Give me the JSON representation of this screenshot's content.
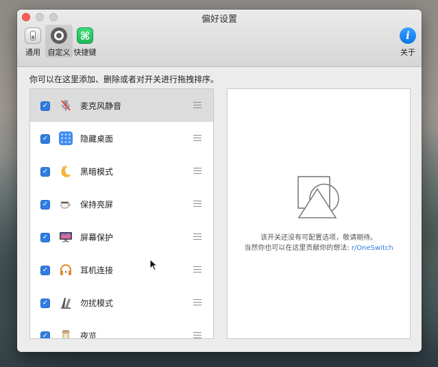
{
  "window": {
    "title": "偏好设置"
  },
  "toolbar": {
    "items": [
      {
        "label": "通用",
        "icon": "toggle-switch-icon"
      },
      {
        "label": "自定义",
        "icon": "custom-knob-icon",
        "active": true
      },
      {
        "label": "快捷键",
        "icon": "command-key-icon"
      }
    ],
    "about": {
      "label": "关于",
      "icon": "info-icon"
    },
    "shortcut_glyph": "⌘",
    "about_glyph": "i"
  },
  "main": {
    "description": "你可以在这里添加、删除或者对开关进行拖拽排序。",
    "switches": [
      {
        "label": "麦克风静音",
        "icon": "microphone-muted-icon",
        "checked": true,
        "selected": true
      },
      {
        "label": "隐藏桌面",
        "icon": "desktop-grid-icon",
        "checked": true
      },
      {
        "label": "黑暗模式",
        "icon": "moon-icon",
        "checked": true
      },
      {
        "label": "保持亮屏",
        "icon": "coffee-cup-icon",
        "checked": true
      },
      {
        "label": "屏幕保护",
        "icon": "monitor-icon",
        "checked": true
      },
      {
        "label": "耳机连接",
        "icon": "headphones-icon",
        "checked": true
      },
      {
        "label": "勿扰模式",
        "icon": "do-not-disturb-icon",
        "checked": true
      },
      {
        "label": "夜览",
        "icon": "night-shift-icon",
        "checked": true
      }
    ],
    "checkmark": "✓"
  },
  "detail": {
    "line1": "该开关还没有可配置选项，敬请期待。",
    "line2_prefix": "当然你也可以在这里贡献你的想法: ",
    "link_text": "r/OneSwitch"
  },
  "colors": {
    "accent": "#2f7de1",
    "selected_row": "#dcdcdc",
    "close_button": "#fe5f57"
  }
}
